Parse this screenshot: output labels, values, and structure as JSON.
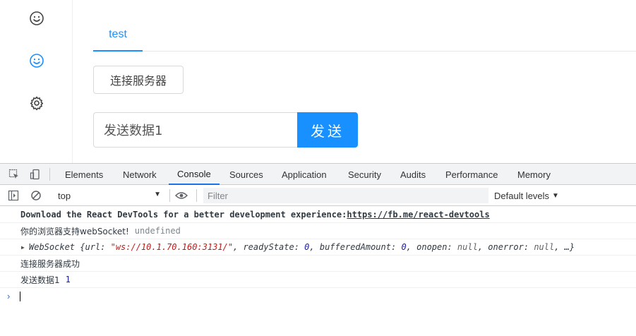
{
  "sidebar": {
    "icons": [
      {
        "name": "smile-icon",
        "active": false
      },
      {
        "name": "smile-icon",
        "active": true
      },
      {
        "name": "gear-icon",
        "active": false
      }
    ]
  },
  "tabs": [
    {
      "label": "test",
      "active": true
    }
  ],
  "connect_button": {
    "label": "连接服务器"
  },
  "send_input": {
    "value": "发送数据1"
  },
  "send_button": {
    "label": "发送"
  },
  "colors": {
    "accent": "#1890ff",
    "devtools_accent": "#1a73e8"
  },
  "devtools": {
    "tabs": [
      "Elements",
      "Network",
      "Console",
      "Sources",
      "Application",
      "Security",
      "Audits",
      "Performance",
      "Memory"
    ],
    "active_tab": "Console",
    "toolbar": {
      "context": "top",
      "filter_placeholder": "Filter",
      "levels_label": "Default levels"
    },
    "console_lines": {
      "react_prefix": "Download the React DevTools for a better development experience: ",
      "react_link": "https://fb.me/react-devtools",
      "support_text": "你的浏览器支持webSocket!",
      "support_value": "undefined",
      "ws_name": "WebSocket",
      "ws_open": " {url: ",
      "ws_url": "\"ws://10.1.70.160:3131/\"",
      "ws_ready_key": ", readyState: ",
      "ws_ready_val": "0",
      "ws_buffered_key": ", bufferedAmount: ",
      "ws_buffered_val": "0",
      "ws_onopen_key": ", onopen: ",
      "ws_onopen_val": "null",
      "ws_onerror_key": ", onerror: ",
      "ws_onerror_val": "null",
      "ws_tail": ", …}",
      "connected_text": "连接服务器成功",
      "sent_text": "发送数据1",
      "sent_value": "1"
    }
  }
}
